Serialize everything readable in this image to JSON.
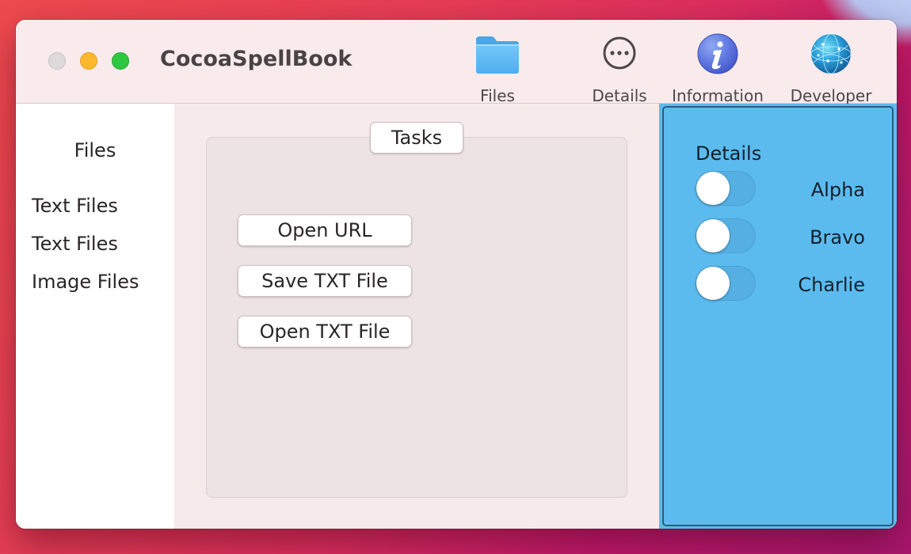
{
  "window": {
    "title": "CocoaSpellBook"
  },
  "toolbar": {
    "items": [
      {
        "label": "Files",
        "icon": "folder-icon"
      },
      {
        "label": "Details",
        "icon": "ellipsis-circle-icon"
      },
      {
        "label": "Information",
        "icon": "info-icon"
      },
      {
        "label": "Developer",
        "icon": "network-globe-icon"
      }
    ]
  },
  "sidebar": {
    "title": "Files",
    "items": [
      {
        "label": "Text Files"
      },
      {
        "label": "Text Files"
      },
      {
        "label": "Image Files"
      }
    ]
  },
  "main": {
    "group_title": "Tasks",
    "buttons": [
      {
        "label": "Open URL"
      },
      {
        "label": "Save TXT File"
      },
      {
        "label": "Open TXT File"
      }
    ]
  },
  "details": {
    "title": "Details",
    "toggles": [
      {
        "label": "Alpha",
        "on": false
      },
      {
        "label": "Bravo",
        "on": false
      },
      {
        "label": "Charlie",
        "on": false
      }
    ]
  },
  "colors": {
    "details_panel_bg": "#5bbbef",
    "window_bg": "#f6eaeb",
    "close_light": "#dedadb",
    "minimize_light": "#fcb82c",
    "maximize_light": "#2ec840"
  }
}
